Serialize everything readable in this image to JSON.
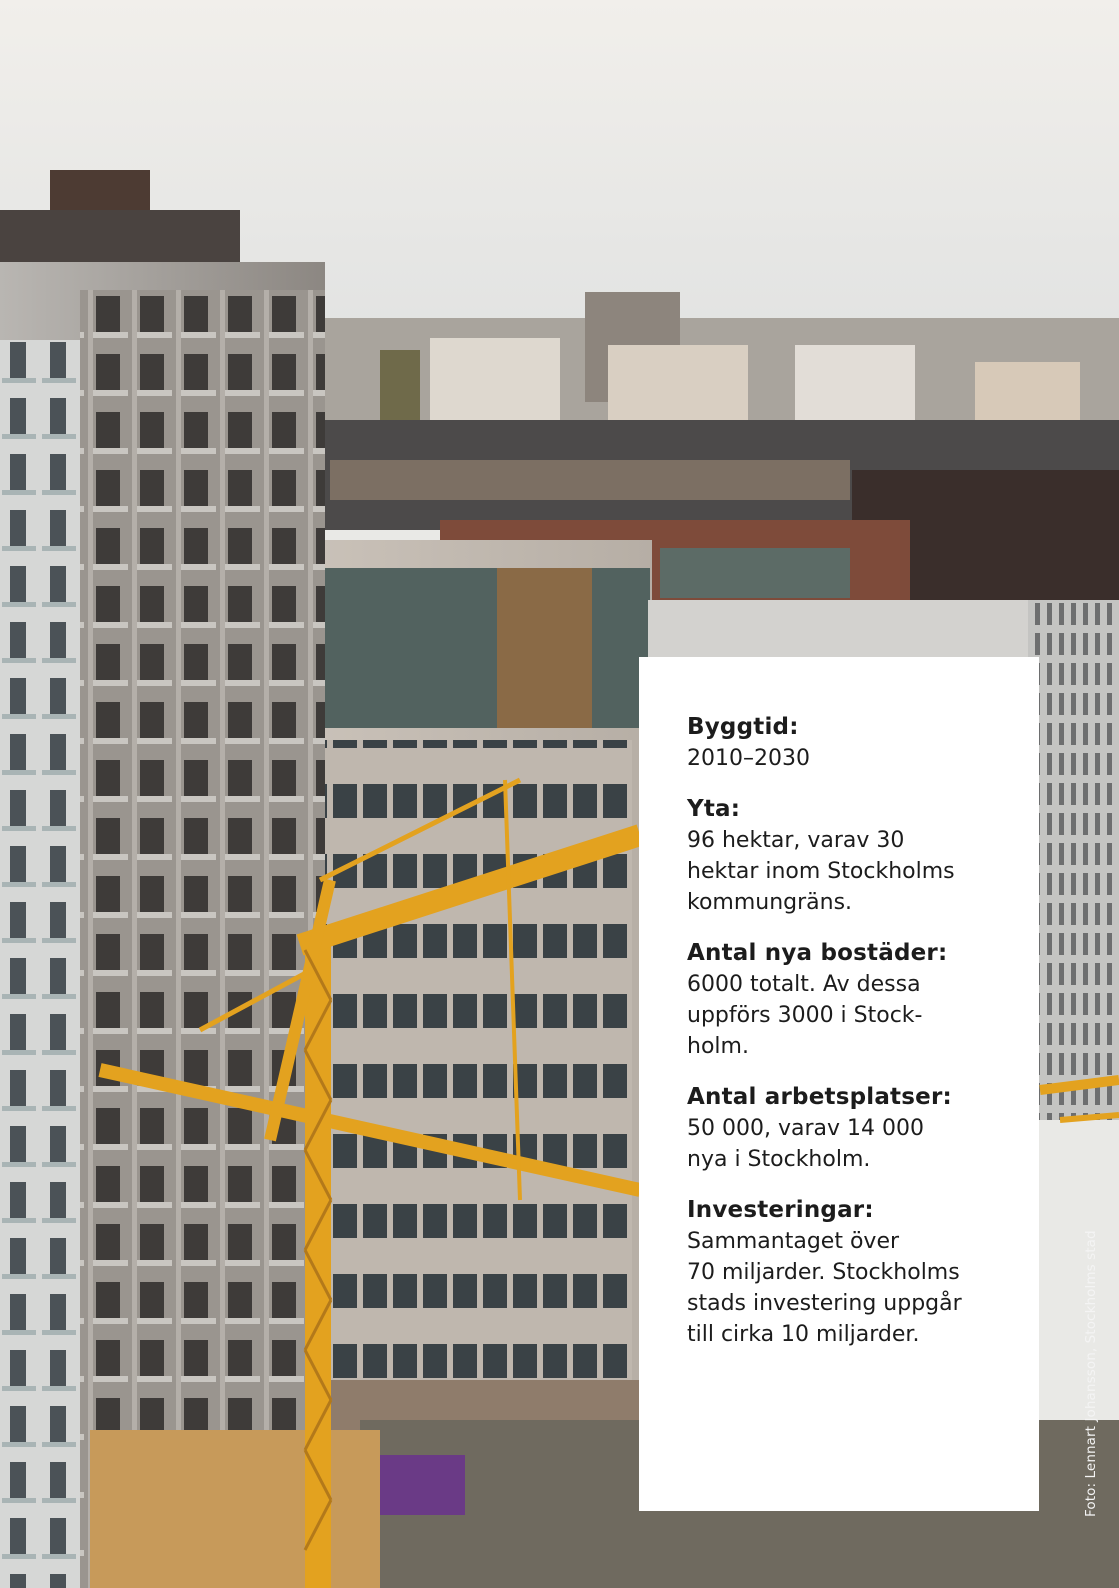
{
  "photo": {
    "colors": {
      "sky": "#eceae6",
      "tower": "#8f8a85",
      "crane": "#e3a21f",
      "office": "#c6bfb6",
      "glass": "#4f6066"
    }
  },
  "info_card": {
    "facts": [
      {
        "label": "Byggtid:",
        "value": "2010–2030"
      },
      {
        "label": "Yta:",
        "value": "96 hektar, varav 30\nhektar inom Stockholms\nkommungräns."
      },
      {
        "label": "Antal nya bostäder:",
        "value": "6000 totalt. Av dessa\nuppförs 3000 i Stock-\nholm."
      },
      {
        "label": "Antal arbetsplatser:",
        "value": "50 000, varav 14 000\nnya i Stockholm."
      },
      {
        "label": "Investeringar:",
        "value": "Sammantaget över\n70 miljarder. Stockholms\nstads investering uppgår\ntill cirka 10 miljarder."
      }
    ]
  },
  "credit": {
    "text": "Foto: Lennart Johansson, Stockholms stad"
  }
}
